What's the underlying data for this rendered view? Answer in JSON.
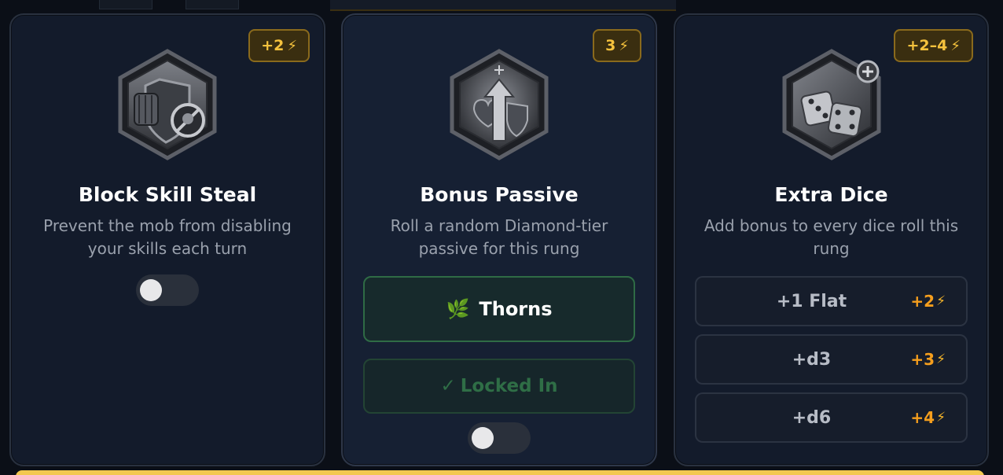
{
  "cards": {
    "block": {
      "cost": "+2",
      "icon": "gauntlet-skull-shield-icon",
      "title": "Block Skill Steal",
      "description": "Prevent the mob from disabling your skills each turn",
      "enabled": false
    },
    "passive": {
      "cost": "3",
      "icon": "heart-arrow-shield-icon",
      "title": "Bonus Passive",
      "description": "Roll a random Diamond-tier passive for this rung",
      "rolled_emoji": "🌿",
      "rolled_name": "Thorns",
      "locked_check": "✓",
      "locked_label": "Locked In",
      "enabled": false
    },
    "dice": {
      "cost": "+2–4",
      "icon": "dice-plus-icon",
      "title": "Extra Dice",
      "description": "Add bonus to every dice roll this rung",
      "options": [
        {
          "label": "+1 Flat",
          "cost": "+2"
        },
        {
          "label": "+d3",
          "cost": "+3"
        },
        {
          "label": "+d6",
          "cost": "+4"
        }
      ]
    }
  },
  "bolt_glyph": "⚡",
  "colors": {
    "accent_gold": "#f5c23d",
    "cost_orange": "#f59e1d",
    "passive_green": "#2f6b45"
  }
}
